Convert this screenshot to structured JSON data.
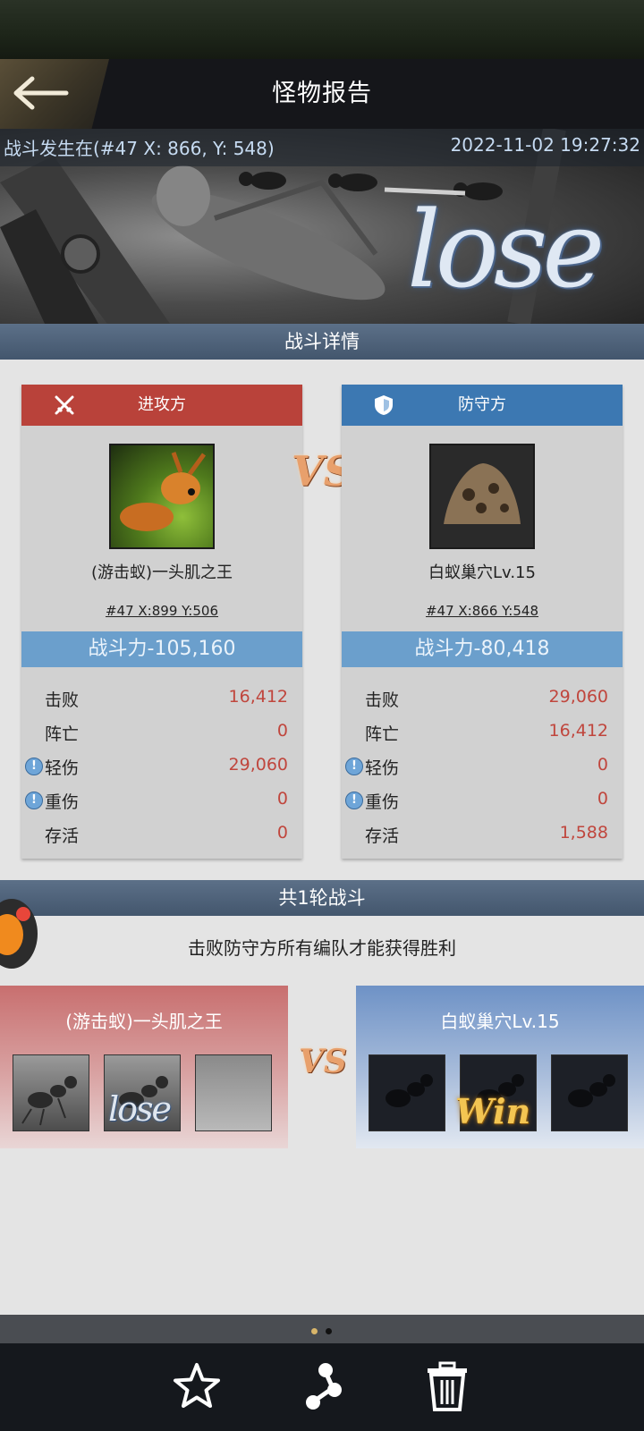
{
  "header": {
    "title": "怪物报告"
  },
  "banner": {
    "location": "战斗发生在(#47 X: 866, Y: 548)",
    "timestamp": "2022-11-02 19:27:32",
    "result_text": "lose"
  },
  "details_section": {
    "title": "战斗详情"
  },
  "attacker": {
    "role": "进攻方",
    "name": "(游击蚁)一头肌之王",
    "coords": "#47  X:899  Y:506",
    "power": "战斗力-105,160",
    "stats": [
      {
        "label": "击败",
        "value": "16,412",
        "warn": false
      },
      {
        "label": "阵亡",
        "value": "0",
        "warn": false
      },
      {
        "label": "轻伤",
        "value": "29,060",
        "warn": true
      },
      {
        "label": "重伤",
        "value": "0",
        "warn": true
      },
      {
        "label": "存活",
        "value": "0",
        "warn": false
      }
    ]
  },
  "defender": {
    "role": "防守方",
    "name": "白蚁巢穴Lv.15",
    "coords": "#47  X:866  Y:548",
    "power": "战斗力-80,418",
    "stats": [
      {
        "label": "击败",
        "value": "29,060",
        "warn": false
      },
      {
        "label": "阵亡",
        "value": "16,412",
        "warn": false
      },
      {
        "label": "轻伤",
        "value": "0",
        "warn": true
      },
      {
        "label": "重伤",
        "value": "0",
        "warn": true
      },
      {
        "label": "存活",
        "value": "1,588",
        "warn": false
      }
    ]
  },
  "vs_text": "VS",
  "warn_glyph": "!",
  "rounds_section": {
    "title": "共1轮战斗",
    "description": "击败防守方所有编队才能获得胜利",
    "attacker_team": "(游击蚁)一头肌之王",
    "defender_team": "白蚁巢穴Lv.15",
    "attacker_result": "lose",
    "defender_result": "Win"
  },
  "colors": {
    "attacker_red": "#b9423a",
    "defender_blue": "#3c78b2",
    "power_bar": "#6b9fcc",
    "value_red": "#c0463d"
  },
  "pagination": {
    "current": 1,
    "total": 2
  },
  "toolbar": {
    "icons": [
      "star-icon",
      "share-icon",
      "trash-icon"
    ]
  }
}
